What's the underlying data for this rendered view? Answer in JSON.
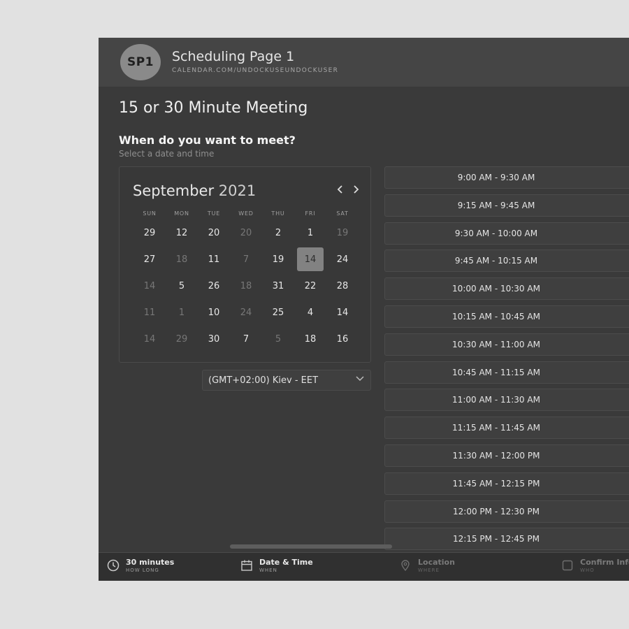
{
  "header": {
    "avatar_initials": "SP1",
    "page_name": "Scheduling Page 1",
    "page_url": "CALENDAR.COM/UNDOCKUSEUNDOCKUSER"
  },
  "meeting": {
    "title": "15 or 30 Minute Meeting",
    "question": "When do you want to meet?",
    "subtitle": "Select a date and time"
  },
  "calendar": {
    "month": "September",
    "year": "2021",
    "prev_icon": "chevron-left-icon",
    "next_icon": "chevron-right-icon",
    "weekdays": [
      "SUN",
      "MON",
      "TUE",
      "WED",
      "THU",
      "FRI",
      "SAT"
    ],
    "days": [
      {
        "label": "29",
        "dim": false
      },
      {
        "label": "12",
        "dim": false
      },
      {
        "label": "20",
        "dim": false
      },
      {
        "label": "20",
        "dim": true
      },
      {
        "label": "2",
        "dim": false
      },
      {
        "label": "1",
        "dim": false
      },
      {
        "label": "19",
        "dim": true
      },
      {
        "label": "27",
        "dim": false
      },
      {
        "label": "18",
        "dim": true
      },
      {
        "label": "11",
        "dim": false
      },
      {
        "label": "7",
        "dim": true
      },
      {
        "label": "19",
        "dim": false
      },
      {
        "label": "14",
        "dim": false,
        "selected": true
      },
      {
        "label": "24",
        "dim": false
      },
      {
        "label": "14",
        "dim": true
      },
      {
        "label": "5",
        "dim": false
      },
      {
        "label": "26",
        "dim": false
      },
      {
        "label": "18",
        "dim": true
      },
      {
        "label": "31",
        "dim": false
      },
      {
        "label": "22",
        "dim": false
      },
      {
        "label": "28",
        "dim": false
      },
      {
        "label": "11",
        "dim": true
      },
      {
        "label": "1",
        "dim": true
      },
      {
        "label": "10",
        "dim": false
      },
      {
        "label": "24",
        "dim": true
      },
      {
        "label": "25",
        "dim": false
      },
      {
        "label": "4",
        "dim": false
      },
      {
        "label": "14",
        "dim": false
      },
      {
        "label": "14",
        "dim": true
      },
      {
        "label": "29",
        "dim": true
      },
      {
        "label": "30",
        "dim": false
      },
      {
        "label": "7",
        "dim": false
      },
      {
        "label": "5",
        "dim": true
      },
      {
        "label": "18",
        "dim": false
      },
      {
        "label": "16",
        "dim": false
      }
    ],
    "selected_day": "14"
  },
  "timezone": {
    "value": "(GMT+02:00) Kiev - EET",
    "icon": "chevron-down-icon"
  },
  "time_slots": [
    "9:00 AM - 9:30 AM",
    "9:15 AM - 9:45 AM",
    "9:30 AM - 10:00 AM",
    "9:45 AM - 10:15 AM",
    "10:00 AM - 10:30 AM",
    "10:15 AM - 10:45 AM",
    "10:30 AM - 11:00 AM",
    "10:45 AM - 11:15 AM",
    "11:00 AM - 11:30 AM",
    "11:15 AM - 11:45 AM",
    "11:30 AM - 12:00 PM",
    "11:45 AM - 12:15 PM",
    "12:00 PM - 12:30 PM",
    "12:15 PM - 12:45 PM"
  ],
  "footer_steps": [
    {
      "label": "30 minutes",
      "sub": "HOW LONG",
      "icon": "clock-icon",
      "muted": false
    },
    {
      "label": "Date & Time",
      "sub": "WHEN",
      "icon": "calendar-icon",
      "muted": false
    },
    {
      "label": "Location",
      "sub": "WHERE",
      "icon": "location-pin-icon",
      "muted": true
    },
    {
      "label": "Confirm Info",
      "sub": "WHO",
      "icon": "checkbox-icon",
      "muted": true
    }
  ]
}
